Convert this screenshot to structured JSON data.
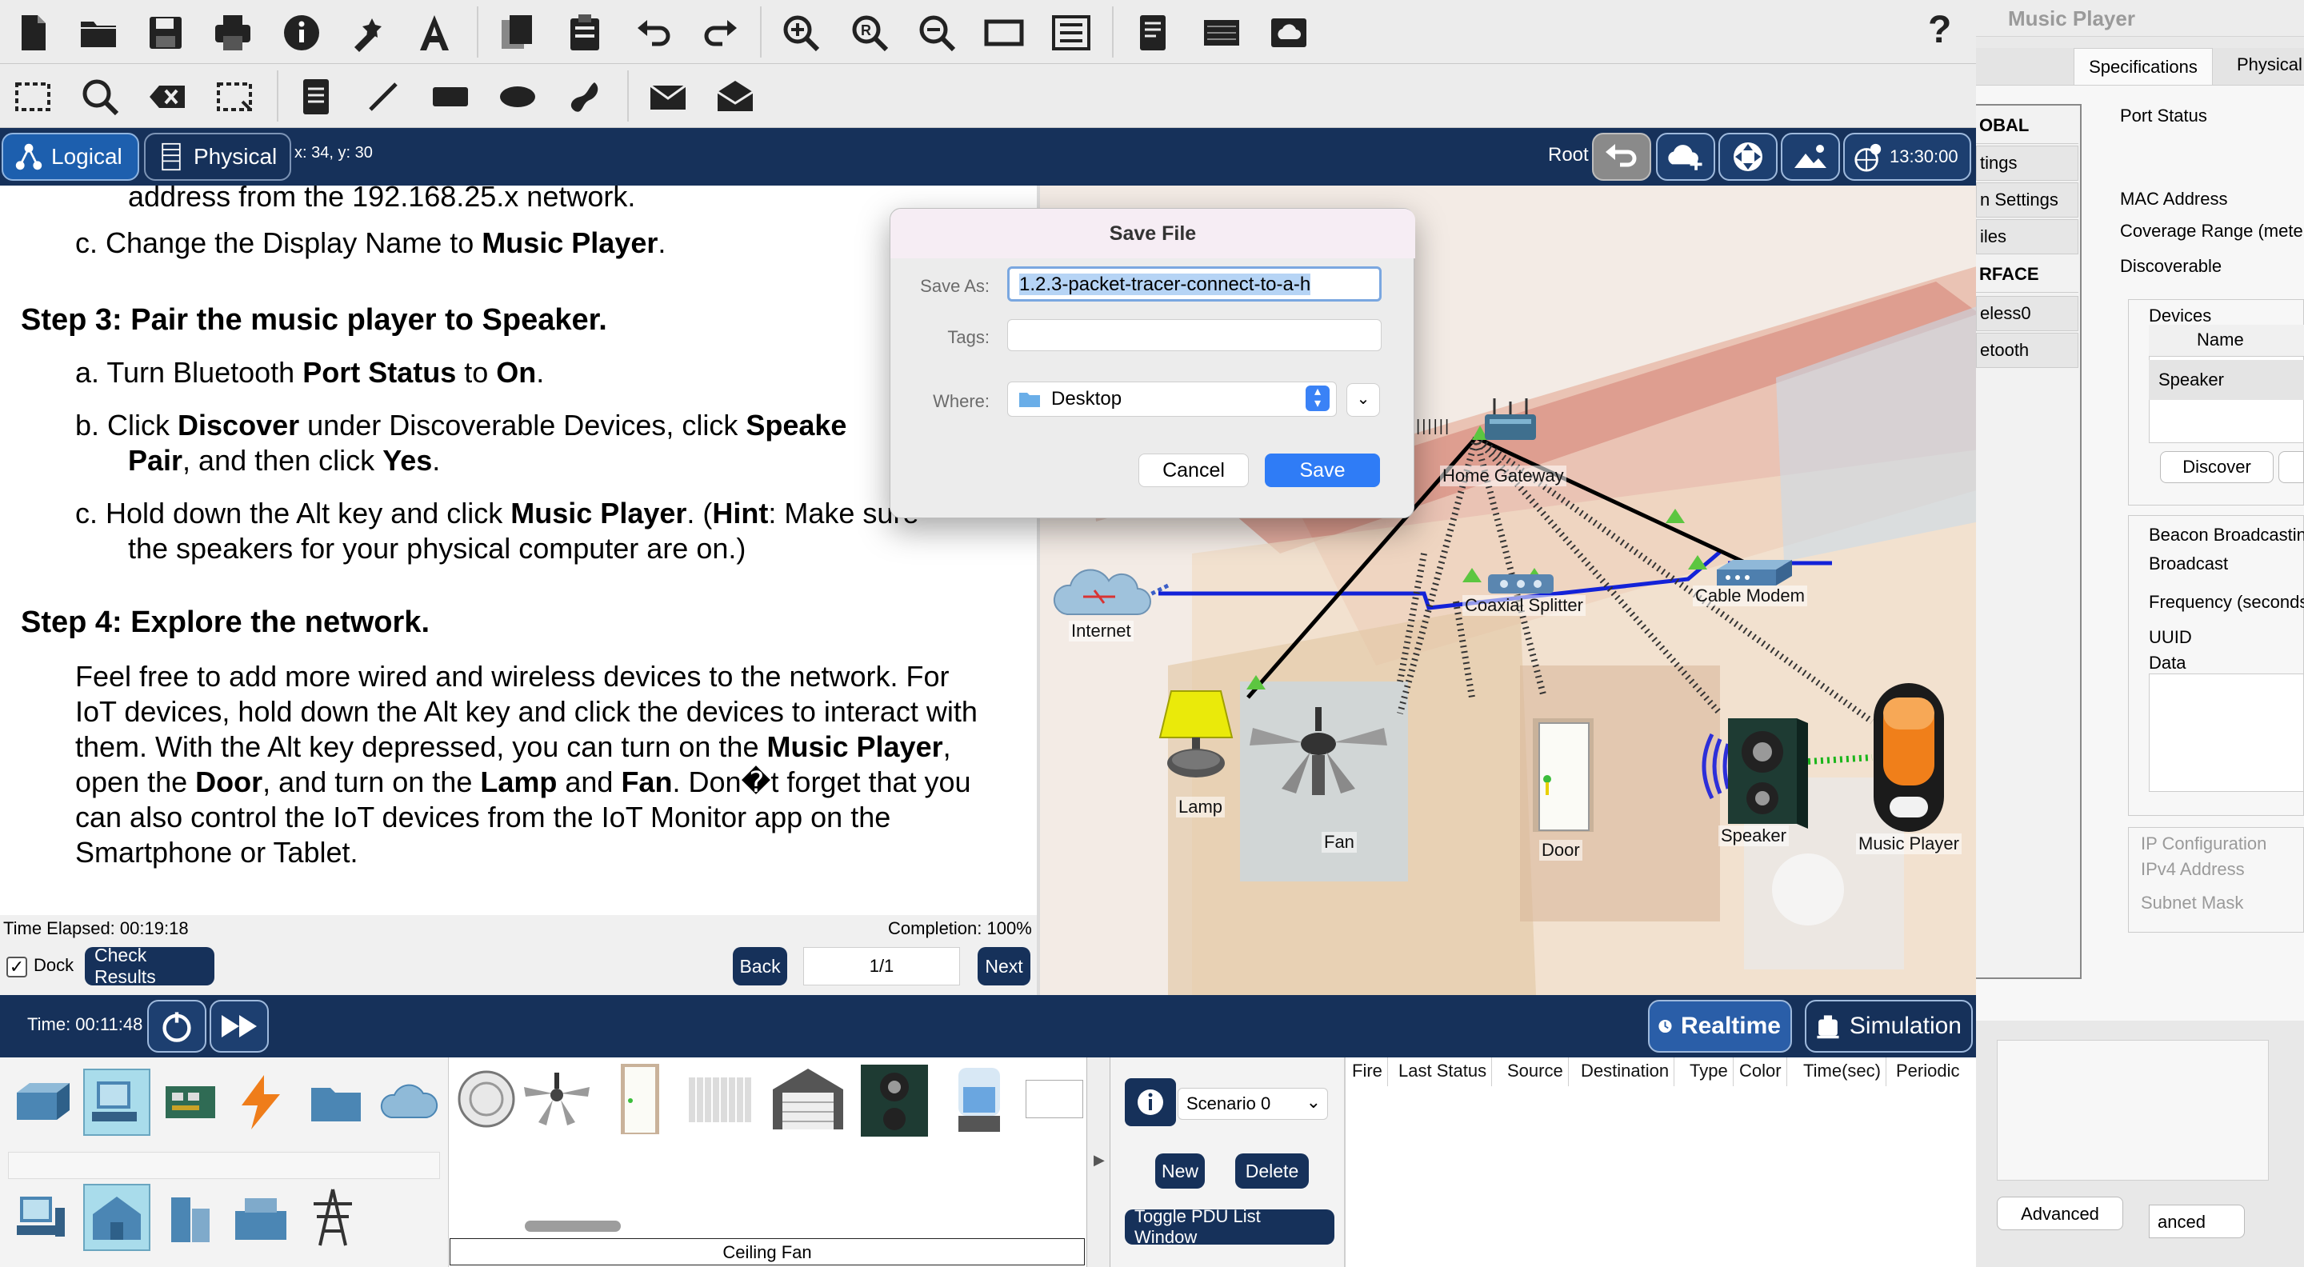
{
  "toolbar": {
    "row1_icons": [
      "new-file-icon",
      "open-folder-icon",
      "save-icon",
      "print-icon",
      "info-icon",
      "activity-wizard-icon",
      "text-tool-icon",
      "copy-icon",
      "paste-icon",
      "undo-icon",
      "redo-icon",
      "zoom-in-icon",
      "zoom-reset-icon",
      "zoom-out-icon",
      "viewport-icon",
      "list-icon",
      "notes-icon",
      "hardware-icon",
      "cloud-window-icon",
      "help-icon"
    ],
    "help_label": "?"
  },
  "nav": {
    "logical_label": "Logical",
    "physical_label": "Physical",
    "coords": "x: 34, y: 30",
    "root_label": "Root",
    "clock": "13:30:00"
  },
  "instructions": {
    "line_top": "address from the 192.168.25.x network.",
    "step2c_prefix": "c.   Change the Display Name to ",
    "step2c_bold": "Music Player",
    "step2c_suffix": ".",
    "step3_title": "Step 3: Pair the music player to Speaker.",
    "step3a_prefix": "a.   Turn Bluetooth ",
    "step3a_bold1": "Port Status",
    "step3a_mid": " to ",
    "step3a_bold2": "On",
    "step3a_suffix": ".",
    "step3b_prefix": "b.   Click ",
    "step3b_bold1": "Discover",
    "step3b_mid": " under Discoverable Devices, click ",
    "step3b_bold2": "Speake",
    "step3b_line2_bold": "Pair",
    "step3b_line2_mid": ", and then click ",
    "step3b_line2_bold2": "Yes",
    "step3b_line2_suffix": ".",
    "step3c_prefix": "c.   Hold down the Alt key and click ",
    "step3c_bold": "Music Player",
    "step3c_mid": ". (",
    "step3c_bold2": "Hint",
    "step3c_suffix": ": Make sure",
    "step3c_line2": "the speakers for your physical computer are on.)",
    "step4_title": "Step 4: Explore the network.",
    "step4_l1": "Feel free to add more wired and wireless devices to the network. For",
    "step4_l2": "IoT devices, hold down the Alt key and click the devices to interact with",
    "step4_l3_prefix": "them. With the Alt key depressed, you can turn on the ",
    "step4_l3_bold": "Music Player",
    "step4_l3_suffix": ",",
    "step4_l4_prefix": "open the ",
    "step4_l4_bold1": "Door",
    "step4_l4_mid": ", and turn on the ",
    "step4_l4_bold2": "Lamp",
    "step4_l4_and": " and ",
    "step4_l4_bold3": "Fan",
    "step4_l4_suffix": ". Don�t forget that you",
    "step4_l5": "can also control the IoT devices from the IoT Monitor app on the",
    "step4_l6": "Smartphone or Tablet."
  },
  "footer": {
    "time_elapsed": "Time Elapsed: 00:19:18",
    "completion": "Completion: 100%",
    "dock_label": "Dock",
    "check_results": "Check Results",
    "back": "Back",
    "page": "1/1",
    "next": "Next"
  },
  "devices": {
    "home_gateway": "Home Gateway",
    "internet": "Internet",
    "coaxial_splitter": "Coaxial Splitter",
    "cable_modem": "Cable Modem",
    "lamp": "Lamp",
    "fan": "Fan",
    "door": "Door",
    "speaker": "Speaker",
    "music_player": "Music Player"
  },
  "dialog": {
    "title": "Save File",
    "save_as_label": "Save As:",
    "save_as_value": "1.2.3-packet-tracer-connect-to-a-h",
    "tags_label": "Tags:",
    "where_label": "Where:",
    "where_value": "Desktop",
    "cancel": "Cancel",
    "save": "Save"
  },
  "timebar": {
    "time": "Time: 00:11:48",
    "realtime": "Realtime",
    "simulation": "Simulation"
  },
  "bottom": {
    "selected_device": "Ceiling Fan",
    "scenario": "Scenario 0",
    "new": "New",
    "delete": "Delete",
    "toggle_pdu": "Toggle PDU List Window",
    "pdu_headers": [
      "Fire",
      "Last Status",
      "Source",
      "Destination",
      "Type",
      "Color",
      "Time(sec)",
      "Periodic"
    ]
  },
  "right_window": {
    "title": "Music Player",
    "tab_specs": "Specifications",
    "tab_physical": "Physical",
    "side_items": [
      "OBAL",
      "tings",
      "n Settings",
      "iles",
      "RFACE",
      "eless0",
      "etooth"
    ],
    "port_status": "Port Status",
    "mac_address": "MAC Address",
    "coverage_range": "Coverage Range (mete",
    "discoverable": "Discoverable",
    "devices_label": "Devices",
    "name_col": "Name",
    "speaker_row": "Speaker",
    "discover_btn": "Discover",
    "beacon": "Beacon Broadcastin",
    "broadcast": "Broadcast",
    "frequency": "Frequency (seconds",
    "uuid": "UUID",
    "data": "Data",
    "ip_config": "IP Configuration",
    "ipv4": "IPv4 Address",
    "subnet": "Subnet Mask",
    "advanced": "Advanced",
    "advanced2": "anced"
  }
}
